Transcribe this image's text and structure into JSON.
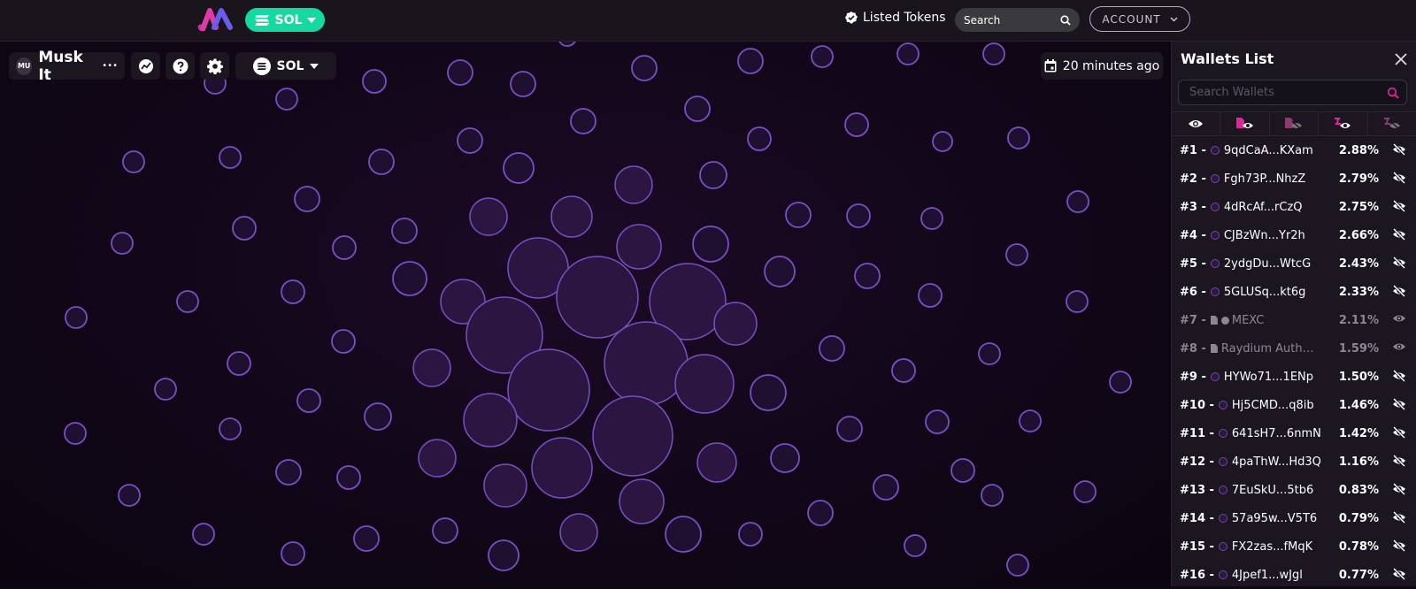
{
  "nav": {
    "chain_label": "SOL",
    "listed_tokens": "Listed Tokens",
    "search_placeholder": "Search",
    "account_label": "ACCOUNT"
  },
  "token": {
    "badge": "MU",
    "name": "Musk It",
    "more": "•••",
    "chain_label": "SOL",
    "updated": "20 minutes ago"
  },
  "sidebar": {
    "title": "Wallets List",
    "search_placeholder": "Search Wallets",
    "wallets": [
      {
        "rank": "#1 -",
        "addr": "9qdCaA...KXam",
        "pct": "2.88%",
        "kind": "wallet"
      },
      {
        "rank": "#2 -",
        "addr": "Fgh73P...NhzZ",
        "pct": "2.79%",
        "kind": "wallet"
      },
      {
        "rank": "#3 -",
        "addr": "4dRcAf...rCzQ",
        "pct": "2.75%",
        "kind": "wallet"
      },
      {
        "rank": "#4 -",
        "addr": "CJBzWn...Yr2h",
        "pct": "2.66%",
        "kind": "wallet"
      },
      {
        "rank": "#5 -",
        "addr": "2ydgDu...WtcG",
        "pct": "2.43%",
        "kind": "wallet"
      },
      {
        "rank": "#6 -",
        "addr": "5GLUSq...kt6g",
        "pct": "2.33%",
        "kind": "wallet"
      },
      {
        "rank": "#7 -",
        "addr": "MEXC",
        "pct": "2.11%",
        "kind": "exchange"
      },
      {
        "rank": "#8 -",
        "addr": "Raydium Authority",
        "pct": "1.59%",
        "kind": "contract"
      },
      {
        "rank": "#9 -",
        "addr": "HYWo71...1ENp",
        "pct": "1.50%",
        "kind": "wallet"
      },
      {
        "rank": "#10 -",
        "addr": "Hj5CMD...q8ib",
        "pct": "1.46%",
        "kind": "wallet"
      },
      {
        "rank": "#11 -",
        "addr": "641sH7...6nmN",
        "pct": "1.42%",
        "kind": "wallet"
      },
      {
        "rank": "#12 -",
        "addr": "4paThW...Hd3Q",
        "pct": "1.16%",
        "kind": "wallet"
      },
      {
        "rank": "#13 -",
        "addr": "7EuSkU...5tb6",
        "pct": "0.83%",
        "kind": "wallet"
      },
      {
        "rank": "#14 -",
        "addr": "57a95w...V5T6",
        "pct": "0.79%",
        "kind": "wallet"
      },
      {
        "rank": "#15 -",
        "addr": "FX2zas...fMqK",
        "pct": "0.78%",
        "kind": "wallet"
      },
      {
        "rank": "#16 -",
        "addr": "4Jpef1...wJgl",
        "pct": "0.77%",
        "kind": "wallet"
      }
    ]
  },
  "colors": {
    "accent": "#14d9a0",
    "bubble_stroke": "#7a4fc4",
    "bubble_fill": "#2a1640",
    "search_icon": "#e0259c"
  }
}
